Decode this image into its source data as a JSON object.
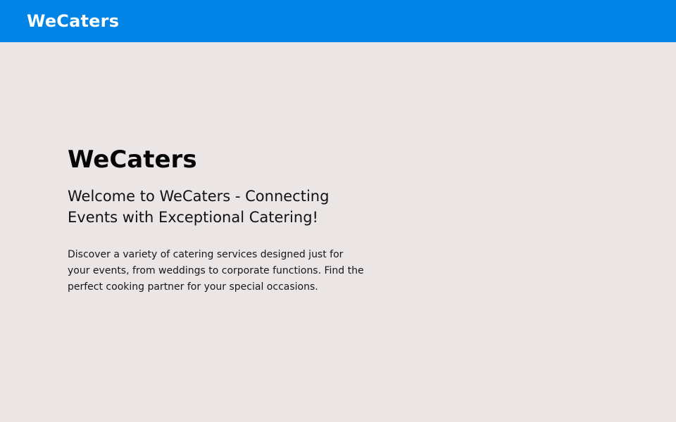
{
  "header": {
    "brand": "WeCaters",
    "background_color": "#0184e5",
    "text_color": "#ffffff"
  },
  "hero": {
    "title": "WeCaters",
    "subtitle": "Welcome to WeCaters - Connecting Events with Exceptional Catering!",
    "description": "Discover a variety of catering services designed just for your events, from weddings to corporate functions. Find the perfect cooking partner for your special occasions."
  },
  "theme": {
    "page_background": "#ebe5e5",
    "text_color": "#111111"
  }
}
